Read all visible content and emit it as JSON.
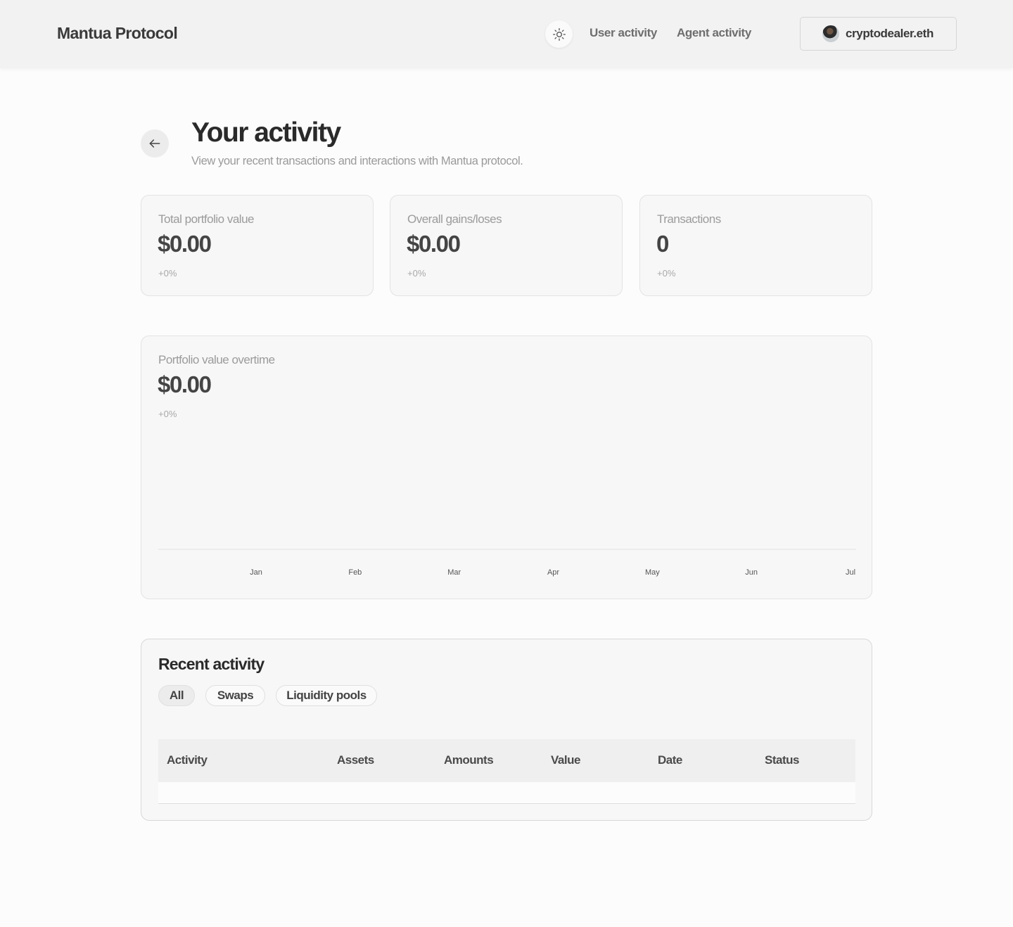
{
  "header": {
    "brand": "Mantua Protocol",
    "theme_icon": "sun-icon",
    "nav": [
      {
        "label": "User activity"
      },
      {
        "label": "Agent activity"
      }
    ],
    "wallet": {
      "name": "cryptodealer.eth"
    }
  },
  "page": {
    "back_icon": "arrow-left-icon",
    "title": "Your activity",
    "subtitle": "View your recent transactions and interactions with Mantua protocol."
  },
  "stats": [
    {
      "label": "Total portfolio value",
      "value": "$0.00",
      "change": "+0%"
    },
    {
      "label": "Overall gains/loses",
      "value": "$0.00",
      "change": "+0%"
    },
    {
      "label": "Transactions",
      "value": "0",
      "change": "+0%"
    }
  ],
  "portfolio_chart": {
    "label": "Portfolio value overtime",
    "value": "$0.00",
    "change": "+0%"
  },
  "chart_data": {
    "type": "line",
    "title": "Portfolio value overtime",
    "x": [
      "Jan",
      "Feb",
      "Mar",
      "Apr",
      "May",
      "Jun",
      "Jul"
    ],
    "series": [],
    "xlabel": "",
    "ylabel": "",
    "grid": false
  },
  "recent": {
    "title": "Recent activity",
    "filters": [
      {
        "label": "All",
        "active": true
      },
      {
        "label": "Swaps",
        "active": false
      },
      {
        "label": "Liquidity pools",
        "active": false
      }
    ],
    "columns": [
      "Activity",
      "Assets",
      "Amounts",
      "Value",
      "Date",
      "Status"
    ],
    "rows": []
  },
  "colors": {
    "background": "#fcfcfc",
    "header_bg": "#f2f2f2",
    "card_bg": "#f7f7f7",
    "text_primary": "#2a2a2a",
    "text_muted": "#9b9b9b"
  }
}
